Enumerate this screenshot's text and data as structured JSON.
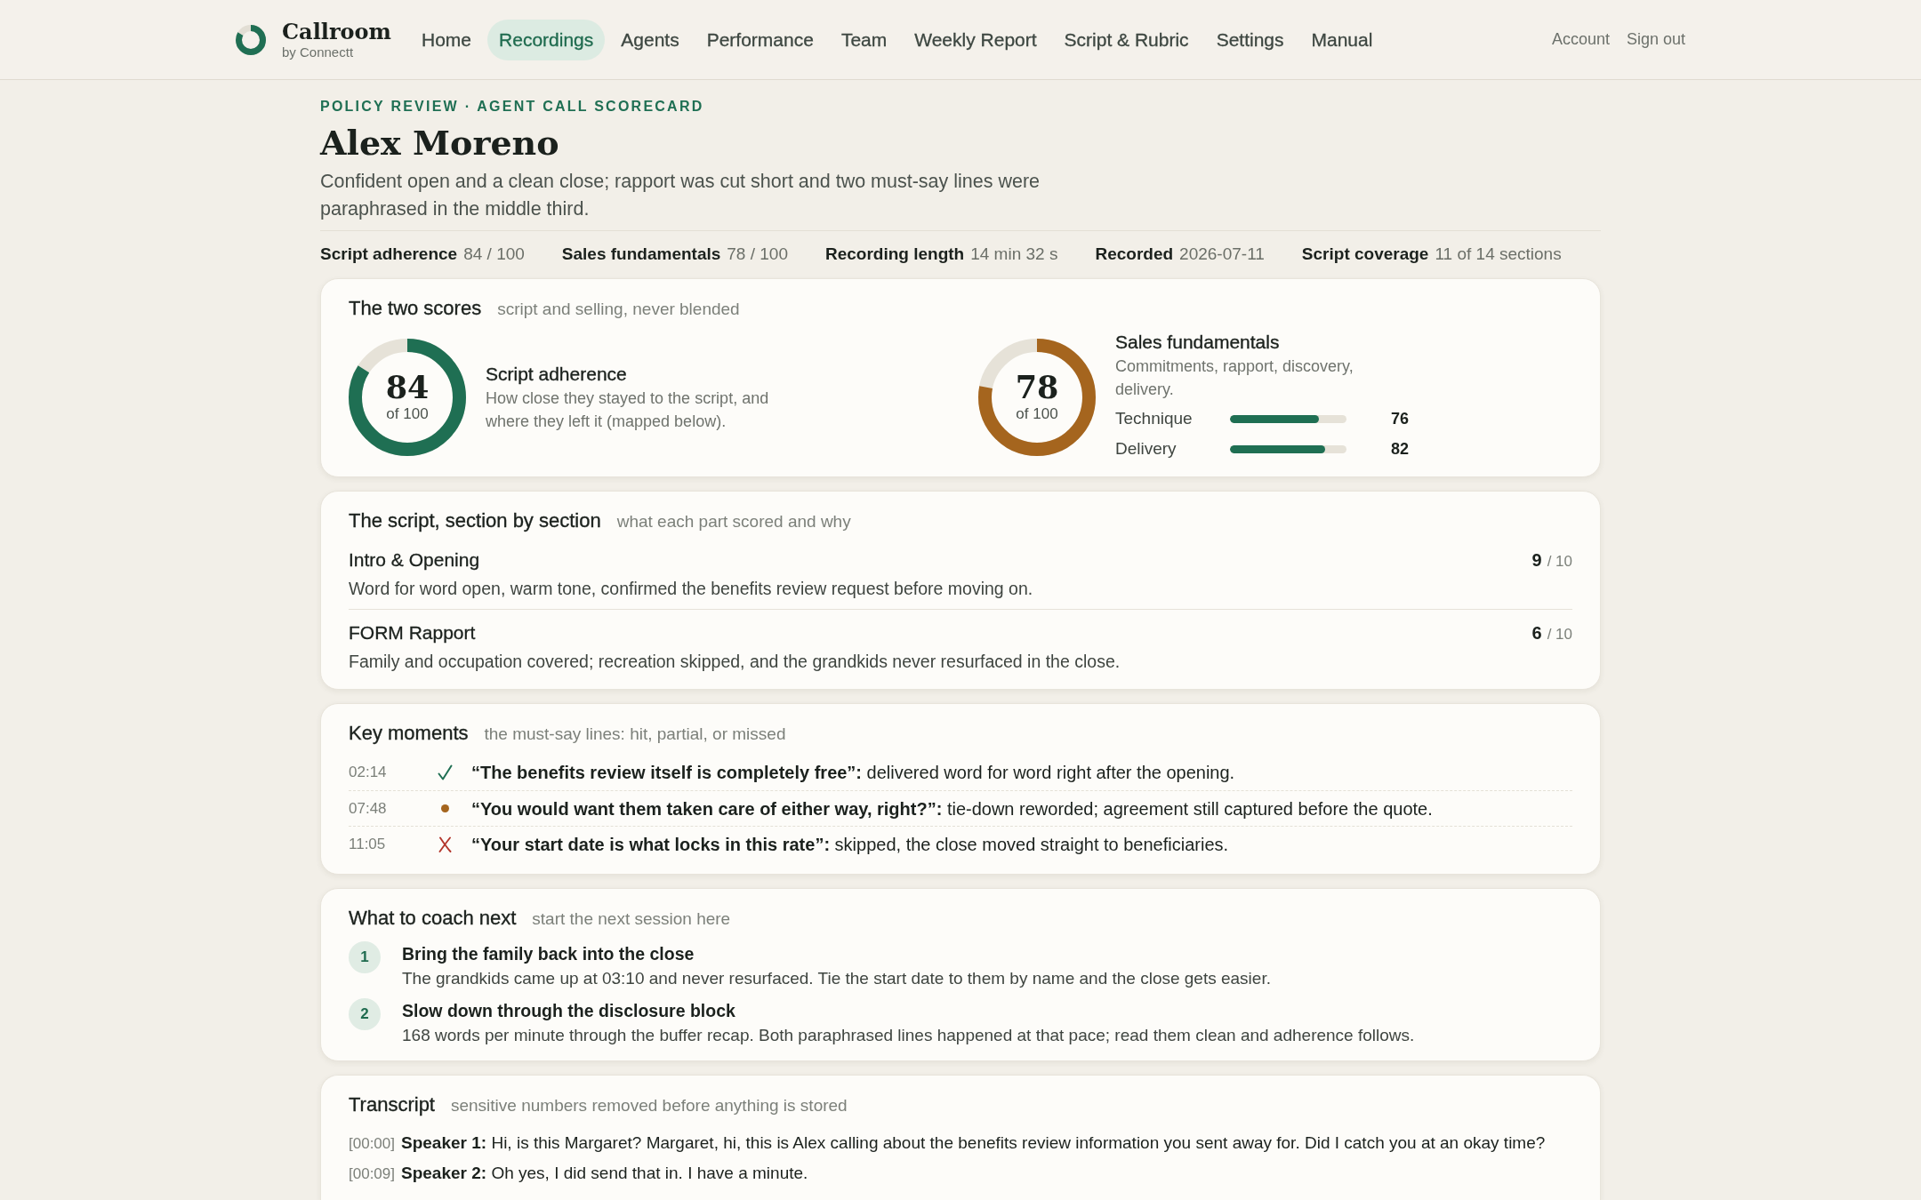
{
  "header": {
    "brand": {
      "name": "Callroom",
      "tagline": "by Connectt"
    },
    "nav": [
      {
        "label": "Home",
        "selected": false
      },
      {
        "label": "Recordings",
        "selected": true
      },
      {
        "label": "Agents",
        "selected": false
      },
      {
        "label": "Performance",
        "selected": false
      },
      {
        "label": "Team",
        "selected": false
      },
      {
        "label": "Weekly Report",
        "selected": false
      },
      {
        "label": "Script & Rubric",
        "selected": false
      },
      {
        "label": "Settings",
        "selected": false
      },
      {
        "label": "Manual",
        "selected": false
      }
    ],
    "account_links": [
      "Account",
      "Sign out"
    ]
  },
  "page": {
    "eyebrow": "POLICY REVIEW · AGENT CALL SCORECARD",
    "title": "Alex Moreno",
    "summary": "Confident open and a clean close; rapport was cut short and two must-say lines were paraphrased in the middle third."
  },
  "stats": [
    {
      "label": "Script adherence",
      "value": "84 / 100"
    },
    {
      "label": "Sales fundamentals",
      "value": "78 / 100"
    },
    {
      "label": "Recording length",
      "value": "14 min 32 s"
    },
    {
      "label": "Recorded",
      "value": "2026-07-11"
    },
    {
      "label": "Script coverage",
      "value": "11 of 14 sections"
    }
  ],
  "scores_card": {
    "title": "The two scores",
    "subtitle": "script and selling, never blended",
    "scores": [
      {
        "score": "84",
        "out_of": "of 100",
        "level": 0.84,
        "color": "#1f6f53",
        "name": "Script adherence",
        "description": "How close they stayed to the script, and where they left it (mapped below)."
      },
      {
        "score": "78",
        "out_of": "of 100",
        "level": 0.78,
        "color": "#a5651e",
        "name": "Sales fundamentals",
        "description": "Commitments, rapport, discovery, delivery.",
        "bars": [
          {
            "label": "Technique",
            "level": 0.76,
            "value": "76"
          },
          {
            "label": "Delivery",
            "level": 0.82,
            "value": "82"
          }
        ]
      }
    ]
  },
  "sections_card": {
    "title": "The script, section by section",
    "subtitle": "what each part scored and why",
    "sections": [
      {
        "name": "Intro & Opening",
        "score": "9",
        "out_of": "/ 10",
        "note": "Word for word open, warm tone, confirmed the benefits review request before moving on."
      },
      {
        "name": "FORM Rapport",
        "score": "6",
        "out_of": "/ 10",
        "note": "Family and occupation covered; recreation skipped, and the grandkids never resurfaced in the close."
      }
    ]
  },
  "moments_card": {
    "title": "Key moments",
    "subtitle": "the must-say lines: hit, partial, or missed",
    "moments": [
      {
        "time": "02:14",
        "kind": "hit",
        "text": "**“The benefits review itself is completely free”:** delivered word for word right after the opening."
      },
      {
        "time": "07:48",
        "kind": "partial",
        "text": "**“You would want them taken care of either way, right?”:** tie-down reworded; agreement still captured before the quote."
      },
      {
        "time": "11:05",
        "kind": "missed",
        "text": "**“Your start date is what locks in this rate”:** skipped, the close moved straight to beneficiaries."
      }
    ]
  },
  "coaching_card": {
    "title": "What to coach next",
    "subtitle": "start the next session here",
    "items": [
      {
        "number": "1",
        "title": "Bring the family back into the close",
        "text": "The grandkids came up at 03:10 and never resurfaced. Tie the start date to them by name and the close gets easier."
      },
      {
        "number": "2",
        "title": "Slow down through the disclosure block",
        "text": "168 words per minute through the buffer recap. Both paraphrased lines happened at that pace; read them clean and adherence follows."
      }
    ]
  },
  "transcript_card": {
    "title": "Transcript",
    "subtitle": "sensitive numbers removed before anything is stored",
    "lines": [
      {
        "time": "[00:00]",
        "speaker": "Speaker 1:",
        "text": "Hi, is this Margaret? Margaret, hi, this is Alex calling about the benefits review information you sent away for. Did I catch you at an okay time?"
      },
      {
        "time": "[00:09]",
        "speaker": "Speaker 2:",
        "text": "Oh yes, I did send that in. I have a minute."
      }
    ]
  }
}
